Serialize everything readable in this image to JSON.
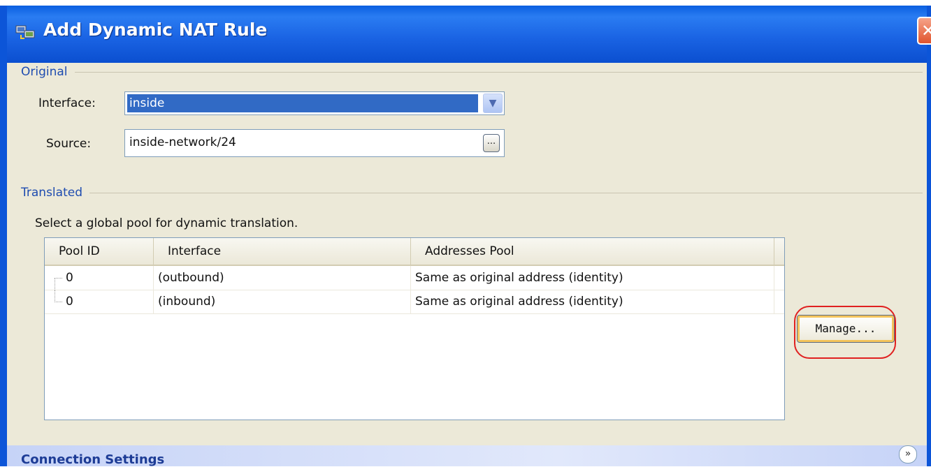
{
  "window": {
    "title": "Add Dynamic NAT Rule",
    "close_label": "✕"
  },
  "original": {
    "group_label": "Original",
    "interface_label": "Interface:",
    "interface_value": "inside",
    "source_label": "Source:",
    "source_value": "inside-network/24",
    "browse_label": "..."
  },
  "translated": {
    "group_label": "Translated",
    "instruction": "Select a global pool for dynamic translation.",
    "columns": [
      "Pool ID",
      "Interface",
      "Addresses Pool"
    ],
    "rows": [
      {
        "pool_id": "0",
        "interface": "(outbound)",
        "addresses_pool": "Same as original address (identity)"
      },
      {
        "pool_id": "0",
        "interface": "(inbound)",
        "addresses_pool": "Same as original address (identity)"
      }
    ],
    "manage_label": "Manage..."
  },
  "connection_settings": {
    "label": "Connection Settings",
    "expand_icon": "double-chevron-down-icon"
  },
  "colors": {
    "title_bar": "#1a63e3",
    "dialog_bg": "#ece9d8",
    "group_label": "#1e4cb0",
    "selection": "#316ac5",
    "highlight": "#e02020"
  }
}
